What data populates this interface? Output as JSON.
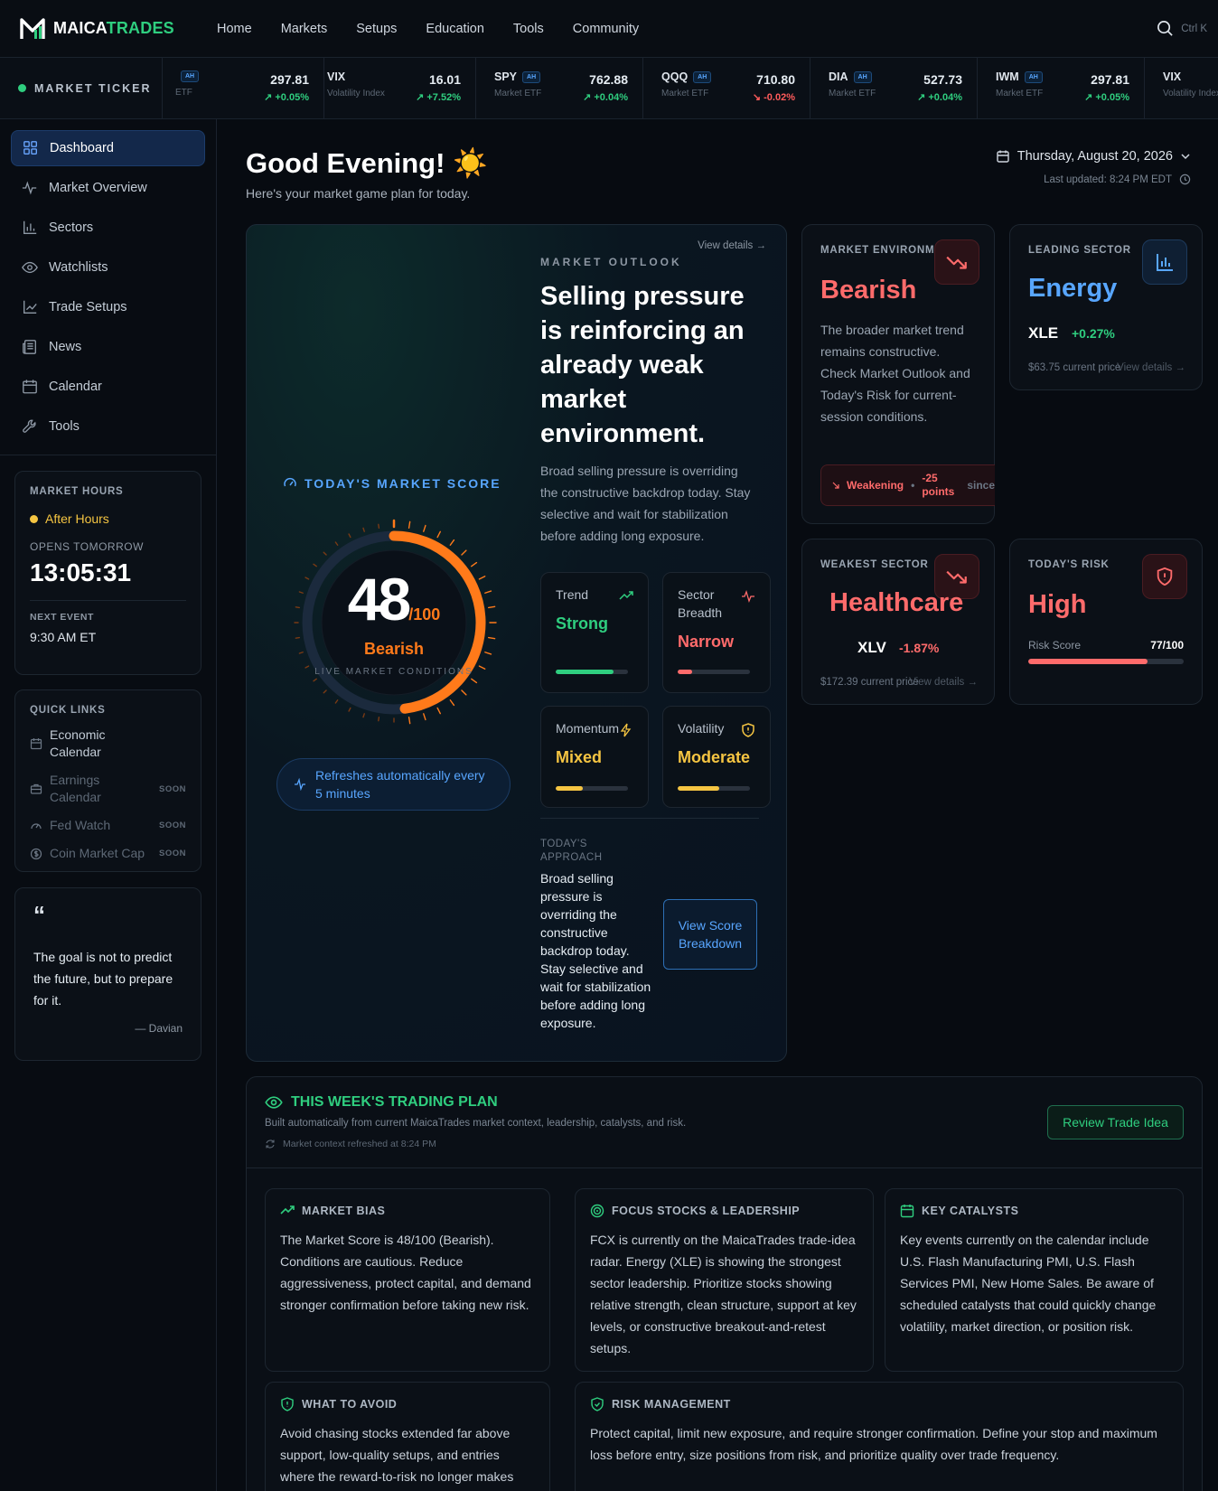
{
  "app": {
    "logo_part1": "MAICA",
    "logo_part2": "TRADES",
    "nav": [
      "Home",
      "Markets",
      "Setups",
      "Education",
      "Tools",
      "Community"
    ],
    "shortcut": "Ctrl K"
  },
  "ticker": {
    "label": "MARKET TICKER",
    "items": [
      {
        "symbol": "",
        "badge": "AH",
        "desc": "ETF",
        "price": "297.81",
        "change": "+0.05%",
        "dir": "up"
      },
      {
        "symbol": "VIX",
        "badge": "",
        "desc": "Volatility Index",
        "price": "16.01",
        "change": "+7.52%",
        "dir": "up"
      },
      {
        "symbol": "SPY",
        "badge": "AH",
        "desc": "Market ETF",
        "price": "762.88",
        "change": "+0.04%",
        "dir": "up"
      },
      {
        "symbol": "QQQ",
        "badge": "AH",
        "desc": "Market ETF",
        "price": "710.80",
        "change": "-0.02%",
        "dir": "down"
      },
      {
        "symbol": "DIA",
        "badge": "AH",
        "desc": "Market ETF",
        "price": "527.73",
        "change": "+0.04%",
        "dir": "up"
      },
      {
        "symbol": "IWM",
        "badge": "AH",
        "desc": "Market ETF",
        "price": "297.81",
        "change": "+0.05%",
        "dir": "up"
      },
      {
        "symbol": "VIX",
        "badge": "",
        "desc": "Volatility Index",
        "price": "",
        "change": "",
        "dir": "up"
      }
    ]
  },
  "sidebar": {
    "items": [
      {
        "label": "Dashboard",
        "icon": "dashboard-icon"
      },
      {
        "label": "Market Overview",
        "icon": "activity-icon"
      },
      {
        "label": "Sectors",
        "icon": "bar-chart-icon"
      },
      {
        "label": "Watchlists",
        "icon": "eye-icon"
      },
      {
        "label": "Trade Setups",
        "icon": "line-chart-icon"
      },
      {
        "label": "News",
        "icon": "newspaper-icon"
      },
      {
        "label": "Calendar",
        "icon": "calendar-icon"
      },
      {
        "label": "Tools",
        "icon": "wrench-icon"
      }
    ],
    "market_hours": {
      "title": "MARKET HOURS",
      "status": "After Hours",
      "opens_label": "OPENS TOMORROW",
      "countdown": "13:05:31",
      "next_label": "NEXT EVENT",
      "next_value": "9:30 AM ET"
    },
    "quick_links": {
      "title": "QUICK LINKS",
      "items": [
        {
          "label": "Economic Calendar",
          "soon": ""
        },
        {
          "label": "Earnings Calendar",
          "soon": "SOON"
        },
        {
          "label": "Fed Watch",
          "soon": "SOON"
        },
        {
          "label": "Coin Market Cap",
          "soon": "SOON"
        }
      ]
    },
    "quote": {
      "mark": "“",
      "text": "The goal is not to predict the future, but to prepare for it.",
      "author": "— Davian"
    }
  },
  "header": {
    "greeting": "Good Evening! ☀️",
    "subtitle": "Here's your market game plan for today.",
    "date": "Thursday, August 20, 2026",
    "updated": "Last updated: 8:24 PM EDT"
  },
  "outlook": {
    "view_details": "View details →",
    "score_title": "TODAY'S MARKET SCORE",
    "score": 48,
    "score_max": "/100",
    "score_label": "Bearish",
    "live": "LIVE MARKET CONDITIONS",
    "refresh": "Refreshes automatically every 5 minutes",
    "section_label": "MARKET OUTLOOK",
    "headline": "Selling pressure is reinforcing an already weak market environment.",
    "body": "Broad selling pressure is overriding the constructive backdrop today. Stay selective and wait for stabilization before adding long exposure.",
    "metrics": [
      {
        "label": "Trend",
        "value": "Strong",
        "color": "#2fce7f",
        "level": 0.8
      },
      {
        "label": "Sector Breadth",
        "value": "Narrow",
        "color": "#ff6b6b",
        "level": 0.2
      },
      {
        "label": "Momentum",
        "value": "Mixed",
        "color": "#f5c542",
        "level": 0.38
      },
      {
        "label": "Volatility",
        "value": "Moderate",
        "color": "#f5c542",
        "level": 0.58
      }
    ],
    "approach_label": "TODAY'S APPROACH",
    "approach": "Broad selling pressure is overriding the constructive backdrop today. Stay selective and wait for stabilization before adding long exposure.",
    "breakdown_btn": "View Score Breakdown"
  },
  "env": {
    "title": "MARKET ENVIRONMENT",
    "value": "Bearish",
    "body": "The broader market trend remains constructive. Check Market Outlook and Today's Risk for current-session conditions.",
    "pill_status": "Weakening",
    "pill_points": "-25 points",
    "pill_since": "since"
  },
  "leading": {
    "title": "LEADING SECTOR",
    "value": "Energy",
    "ticker": "XLE",
    "change": "+0.27%",
    "price": "$63.75 current price",
    "link": "View details →"
  },
  "weakest": {
    "title": "WEAKEST SECTOR",
    "value": "Healthcare",
    "ticker": "XLV",
    "change": "-1.87%",
    "price": "$172.39 current price",
    "link": "View details →"
  },
  "risk": {
    "title": "TODAY'S RISK",
    "value": "High",
    "score_label": "Risk Score",
    "score": "77/100",
    "level": 0.77
  },
  "plan": {
    "title": "THIS WEEK'S TRADING PLAN",
    "subtitle": "Built automatically from current MaicaTrades market context, leadership, catalysts, and risk.",
    "refreshed": "Market context refreshed at 8:24 PM",
    "button": "Review Trade Idea",
    "cards": [
      {
        "title": "MARKET BIAS",
        "text": "The Market Score is 48/100 (Bearish). Conditions are cautious. Reduce aggressiveness, protect capital, and demand stronger confirmation before taking new risk."
      },
      {
        "title": "FOCUS STOCKS & LEADERSHIP",
        "text": "FCX is currently on the MaicaTrades trade-idea radar. Energy (XLE) is showing the strongest sector leadership. Prioritize stocks showing relative strength, clean structure, support at key levels, or constructive breakout-and-retest setups."
      },
      {
        "title": "KEY CATALYSTS",
        "text": "Key events currently on the calendar include U.S. Flash Manufacturing PMI, U.S. Flash Services PMI, New Home Sales. Be aware of scheduled catalysts that could quickly change volatility, market direction, or position risk."
      },
      {
        "title": "WHAT TO AVOID",
        "text": "Avoid chasing stocks extended far above support, low-quality setups, and entries where the reward-to-risk no longer makes sense."
      },
      {
        "title": "RISK MANAGEMENT",
        "text": "Protect capital, limit new exposure, and require stronger confirmation. Define your stop and maximum loss before entry, size positions from risk, and prioritize quality over trade frequency."
      }
    ]
  },
  "colors": {
    "accent": "#2fce7f",
    "bearish": "#ff6b6b",
    "blue": "#58a6ff",
    "score": "#ff7a1a",
    "warn": "#f5c542"
  }
}
